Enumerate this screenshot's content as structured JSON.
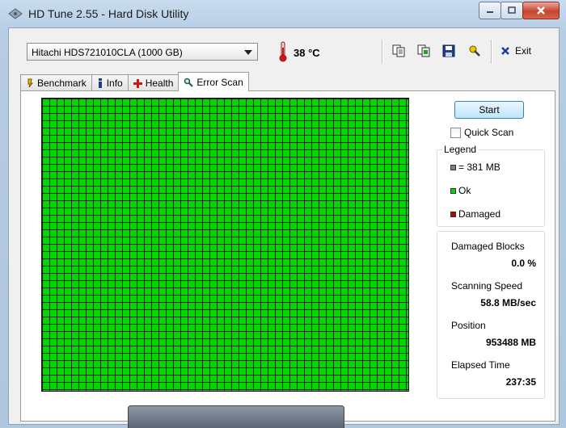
{
  "window": {
    "title": "HD Tune 2.55 - Hard Disk Utility"
  },
  "toolbar": {
    "drive": "Hitachi HDS721010CLA (1000 GB)",
    "temperature": "38 °C",
    "icons": [
      "copy-text-icon",
      "copy-screenshot-icon",
      "save-icon",
      "options-icon"
    ],
    "exit_label": "Exit"
  },
  "tabs": [
    {
      "label": "Benchmark",
      "icon": "benchmark-icon"
    },
    {
      "label": "Info",
      "icon": "info-icon"
    },
    {
      "label": "Health",
      "icon": "health-icon"
    },
    {
      "label": "Error Scan",
      "icon": "magnifier-icon",
      "active": true
    }
  ],
  "scan": {
    "start_label": "Start",
    "quick_scan_label": "Quick Scan",
    "quick_scan_checked": false,
    "legend": {
      "title": "Legend",
      "block_size": "= 381 MB",
      "ok": "Ok",
      "damaged": "Damaged"
    },
    "colors": {
      "ok": "#00d800",
      "damaged": "#c00000",
      "block": "#808080"
    },
    "stats": {
      "damaged_blocks_label": "Damaged Blocks",
      "damaged_blocks_value": "0.0 %",
      "scanning_speed_label": "Scanning Speed",
      "scanning_speed_value": "58.8 MB/sec",
      "position_label": "Position",
      "position_value": "953488 MB",
      "elapsed_label": "Elapsed Time",
      "elapsed_value": "237:35"
    }
  }
}
